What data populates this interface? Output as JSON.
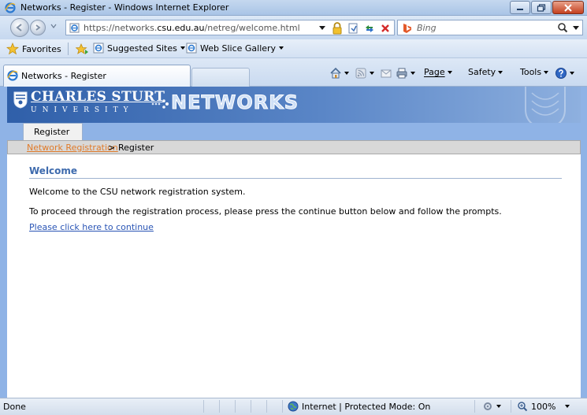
{
  "window": {
    "title": "Networks - Register - Windows Internet Explorer"
  },
  "address_bar": {
    "url_prefix": "https://networks.",
    "url_domain": "csu.edu.au",
    "url_path": "/netreg/welcome.html"
  },
  "search": {
    "placeholder": "Bing"
  },
  "favorites_bar": {
    "favorites_label": "Favorites",
    "suggested_sites": "Suggested Sites",
    "web_slice_gallery": "Web Slice Gallery"
  },
  "tabs": {
    "active_tab": "Networks - Register"
  },
  "command_bar": {
    "page": "Page",
    "safety": "Safety",
    "tools": "Tools"
  },
  "site": {
    "uni_name": "CHARLES STURT",
    "uni_sub": "UNIVERSITY",
    "brand": "NETWORKS",
    "tab_label": "Register",
    "breadcrumb_link": "Network Registration",
    "breadcrumb_sep": ">",
    "breadcrumb_current": "Register",
    "heading": "Welcome",
    "p1": "Welcome to the CSU network registration system.",
    "p2": "To proceed through the registration process, please press the continue button below and follow the prompts.",
    "continue_link": "Please click here to continue"
  },
  "status_bar": {
    "status": "Done",
    "zone": "Internet | Protected Mode: On",
    "zoom": "100%"
  },
  "colors": {
    "accent_blue": "#3d6aad",
    "link_orange": "#e07b2a",
    "link_blue": "#2a55b5",
    "frame_blue": "#8fb3e6"
  }
}
